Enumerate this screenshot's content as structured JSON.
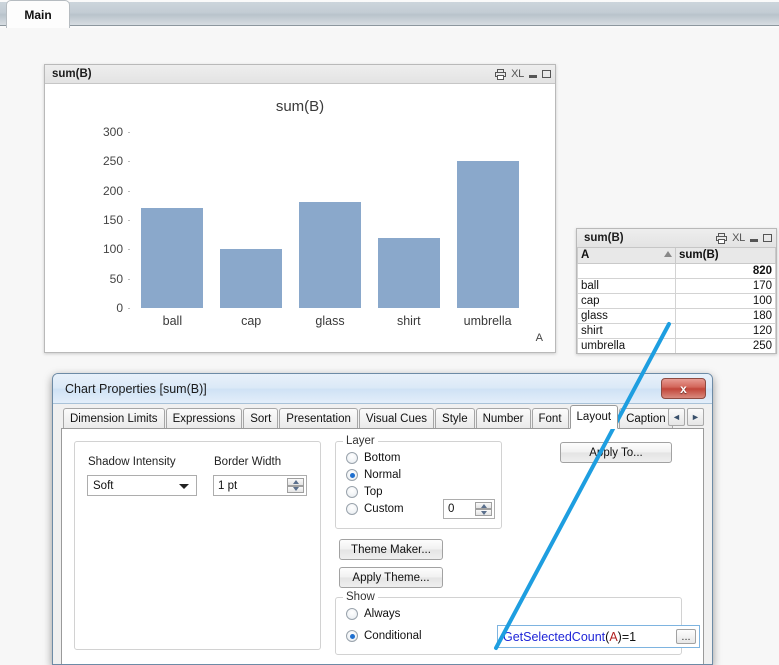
{
  "sheet_tabs": [
    {
      "label": "Main",
      "active": true
    }
  ],
  "chart_window": {
    "title": "sum(B)",
    "icons": [
      "print-icon",
      "XL",
      "minimize-icon",
      "maximize-icon"
    ],
    "xl_label": "XL"
  },
  "chart_data": {
    "type": "bar",
    "title": "sum(B)",
    "xlabel": "A",
    "ylabel": "",
    "categories": [
      "ball",
      "cap",
      "glass",
      "shirt",
      "umbrella"
    ],
    "values": [
      170,
      100,
      180,
      120,
      250
    ],
    "yticks": [
      0,
      50,
      100,
      150,
      200,
      250,
      300
    ],
    "ylim": [
      0,
      300
    ],
    "grid": false,
    "legend": "none",
    "bar_color": "#8aa8cb",
    "series": [
      {
        "name": "sum(B)",
        "values": [
          170,
          100,
          180,
          120,
          250
        ]
      }
    ]
  },
  "table_window": {
    "title": "sum(B)",
    "icons": [
      "print-icon",
      "XL",
      "minimize-icon",
      "maximize-icon"
    ],
    "xl_label": "XL",
    "columns": [
      "A",
      "sum(B)"
    ],
    "total_label": "",
    "total_value": "820",
    "rows": [
      {
        "a": "ball",
        "b": "170"
      },
      {
        "a": "cap",
        "b": "100"
      },
      {
        "a": "glass",
        "b": "180"
      },
      {
        "a": "shirt",
        "b": "120"
      },
      {
        "a": "umbrella",
        "b": "250"
      }
    ]
  },
  "dialog": {
    "title": "Chart Properties [sum(B)]",
    "close_label": "x",
    "tabs": [
      {
        "label": "Dimension Limits",
        "active": false
      },
      {
        "label": "Expressions",
        "active": false
      },
      {
        "label": "Sort",
        "active": false
      },
      {
        "label": "Presentation",
        "active": false
      },
      {
        "label": "Visual Cues",
        "active": false
      },
      {
        "label": "Style",
        "active": false
      },
      {
        "label": "Number",
        "active": false
      },
      {
        "label": "Font",
        "active": false
      },
      {
        "label": "Layout",
        "active": true
      },
      {
        "label": "Caption",
        "active": false
      }
    ],
    "nav_prev": "◄",
    "nav_next": "►",
    "shadow_intensity_label": "Shadow Intensity",
    "shadow_intensity_value": "Soft",
    "border_width_label": "Border Width",
    "border_width_value": "1 pt",
    "layer_legend": "Layer",
    "layer_options": [
      {
        "label": "Bottom",
        "selected": false
      },
      {
        "label": "Normal",
        "selected": true
      },
      {
        "label": "Top",
        "selected": false
      },
      {
        "label": "Custom",
        "selected": false
      }
    ],
    "layer_custom_value": "0",
    "apply_to_label": "Apply To...",
    "theme_maker_label": "Theme Maker...",
    "apply_theme_label": "Apply Theme...",
    "show_legend": "Show",
    "show_options": [
      {
        "label": "Always",
        "selected": false
      },
      {
        "label": "Conditional",
        "selected": true
      }
    ],
    "expression_fn": "GetSelectedCount",
    "expression_open": "(",
    "expression_field": "A",
    "expression_rest": ")=1",
    "expression_browse": "..."
  },
  "annotation": {
    "color": "#1e9ee0",
    "type": "pointer-line"
  }
}
